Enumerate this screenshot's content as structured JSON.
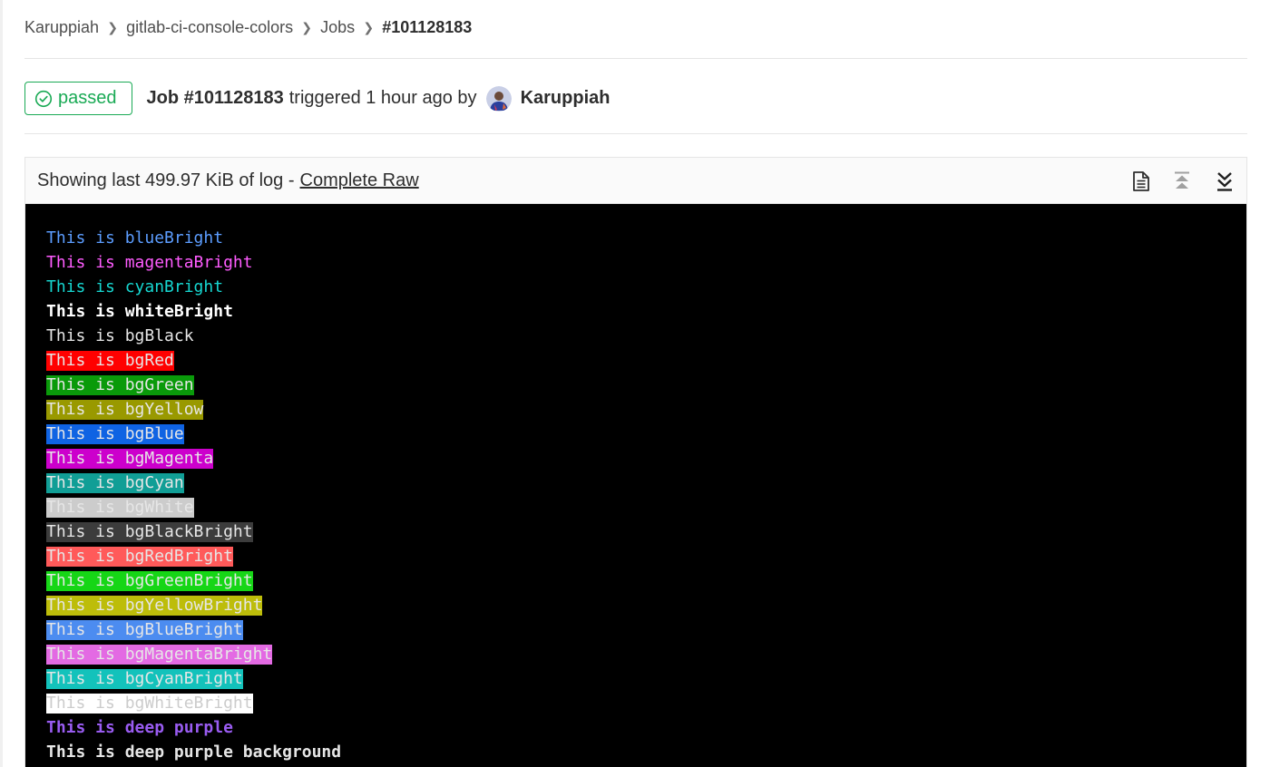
{
  "breadcrumb": {
    "items": [
      "Karuppiah",
      "gitlab-ci-console-colors",
      "Jobs"
    ],
    "current": "#101128183"
  },
  "job": {
    "status": "passed",
    "title": "Job #101128183",
    "meta": "triggered 1 hour ago by",
    "author": "Karuppiah",
    "status_color": "#1aaa55"
  },
  "log": {
    "info_prefix": "Showing last 499.97 KiB of log -",
    "raw_link": "Complete Raw",
    "icons": [
      "raw-file-icon",
      "scroll-top-icon",
      "scroll-bottom-icon"
    ],
    "lines": [
      {
        "text": "This is blueBright",
        "fg": "#5c9dff",
        "bg": "",
        "bold": false
      },
      {
        "text": "This is magentaBright",
        "fg": "#ff5cff",
        "bg": "",
        "bold": false
      },
      {
        "text": "This is cyanBright",
        "fg": "#16d7d1",
        "bg": "",
        "bold": false
      },
      {
        "text": "This is whiteBright",
        "fg": "#ffffff",
        "bg": "",
        "bold": true
      },
      {
        "text": "This is bgBlack",
        "fg": "#e6e6e6",
        "bg": "",
        "bold": false
      },
      {
        "text": "This is bgRed",
        "fg": "#e6e6e6",
        "bg": "#ff0000",
        "bold": false
      },
      {
        "text": "This is bgGreen",
        "fg": "#e6e6e6",
        "bg": "#0a9a0a",
        "bold": false
      },
      {
        "text": "This is bgYellow",
        "fg": "#e6e6e6",
        "bg": "#999900",
        "bold": false
      },
      {
        "text": "This is bgBlue",
        "fg": "#e6e6e6",
        "bg": "#0f63e3",
        "bold": false
      },
      {
        "text": "This is bgMagenta",
        "fg": "#e6e6e6",
        "bg": "#cc00cc",
        "bold": false
      },
      {
        "text": "This is bgCyan",
        "fg": "#e6e6e6",
        "bg": "#119e96",
        "bold": false
      },
      {
        "text": "This is bgWhite",
        "fg": "#e6e6e6",
        "bg": "#cccccc",
        "bold": false
      },
      {
        "text": "This is bgBlackBright",
        "fg": "#e6e6e6",
        "bg": "#3c3c3c",
        "bold": false
      },
      {
        "text": "This is bgRedBright",
        "fg": "#e6e6e6",
        "bg": "#ff5a5a",
        "bold": false
      },
      {
        "text": "This is bgGreenBright",
        "fg": "#e6e6e6",
        "bg": "#16d616",
        "bold": false
      },
      {
        "text": "This is bgYellowBright",
        "fg": "#e6e6e6",
        "bg": "#bdbd0a",
        "bold": false
      },
      {
        "text": "This is bgBlueBright",
        "fg": "#e6e6e6",
        "bg": "#4c8cf0",
        "bold": false
      },
      {
        "text": "This is bgMagentaBright",
        "fg": "#e6e6e6",
        "bg": "#e36ae3",
        "bold": false
      },
      {
        "text": "This is bgCyanBright",
        "fg": "#e6e6e6",
        "bg": "#13c2bb",
        "bold": false
      },
      {
        "text": "This is bgWhiteBright",
        "fg": "#cccccc",
        "bg": "#ffffff",
        "bold": false
      },
      {
        "text": "This is deep purple",
        "fg": "#9a5cf2",
        "bg": "",
        "bold": true
      },
      {
        "text": "This is deep purple background",
        "fg": "#e6e6e6",
        "bg": "",
        "bold": true
      }
    ]
  }
}
